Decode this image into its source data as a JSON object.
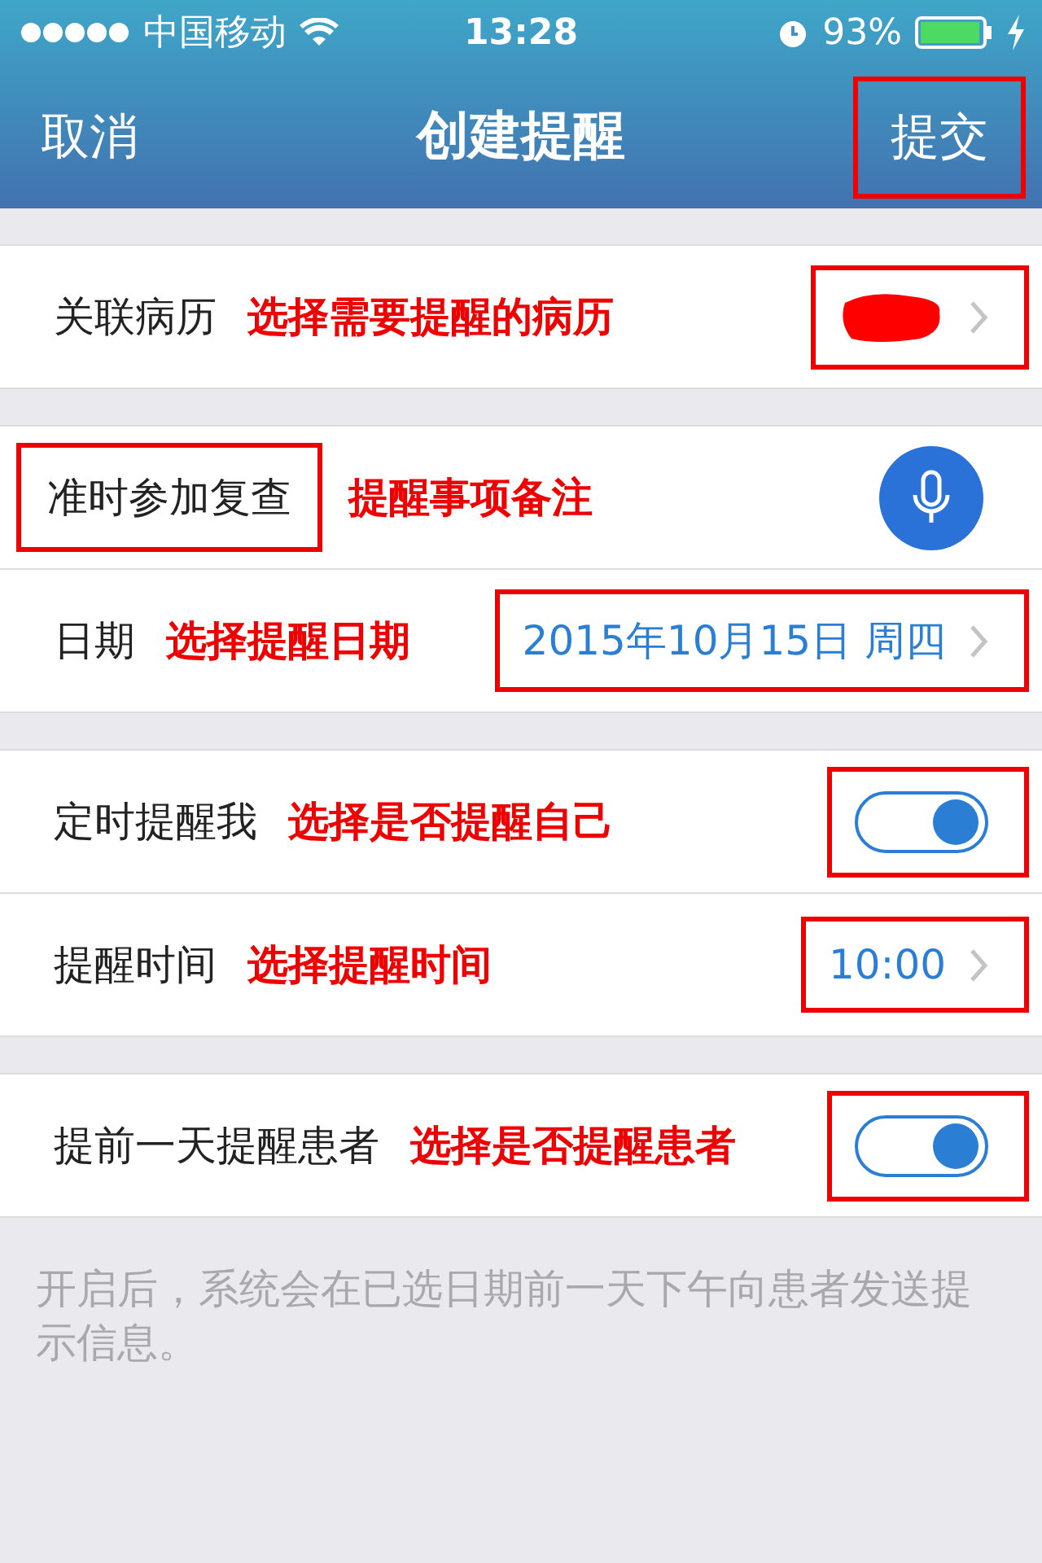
{
  "status_bar": {
    "carrier": "中国移动",
    "time": "13:28",
    "battery": "93%"
  },
  "nav": {
    "cancel": "取消",
    "title": "创建提醒",
    "submit": "提交",
    "submit_annotated": true
  },
  "sections": [
    {
      "rows": [
        {
          "kind": "link",
          "label": "关联病历",
          "note": "选择需要提醒的病历",
          "redacted": true,
          "annotated": true
        }
      ]
    },
    {
      "rows": [
        {
          "kind": "voice",
          "label": "准时参加复查",
          "label_annotated": true,
          "note": "提醒事项备注"
        },
        {
          "kind": "link",
          "label": "日期",
          "note": "选择提醒日期",
          "value": "2015年10月15日 周四",
          "annotated": true
        }
      ]
    },
    {
      "rows": [
        {
          "kind": "toggle",
          "label": "定时提醒我",
          "note": "选择是否提醒自己",
          "on": true,
          "annotated": true
        },
        {
          "kind": "link",
          "label": "提醒时间",
          "note": "选择提醒时间",
          "value": "10:00",
          "annotated": true
        }
      ]
    },
    {
      "rows": [
        {
          "kind": "toggle",
          "label": "提前一天提醒患者",
          "note": "选择是否提醒患者",
          "on": true,
          "annotated": true
        }
      ]
    }
  ],
  "footer": "开启后，系统会在已选日期前一天下午向患者发送提示信息。"
}
